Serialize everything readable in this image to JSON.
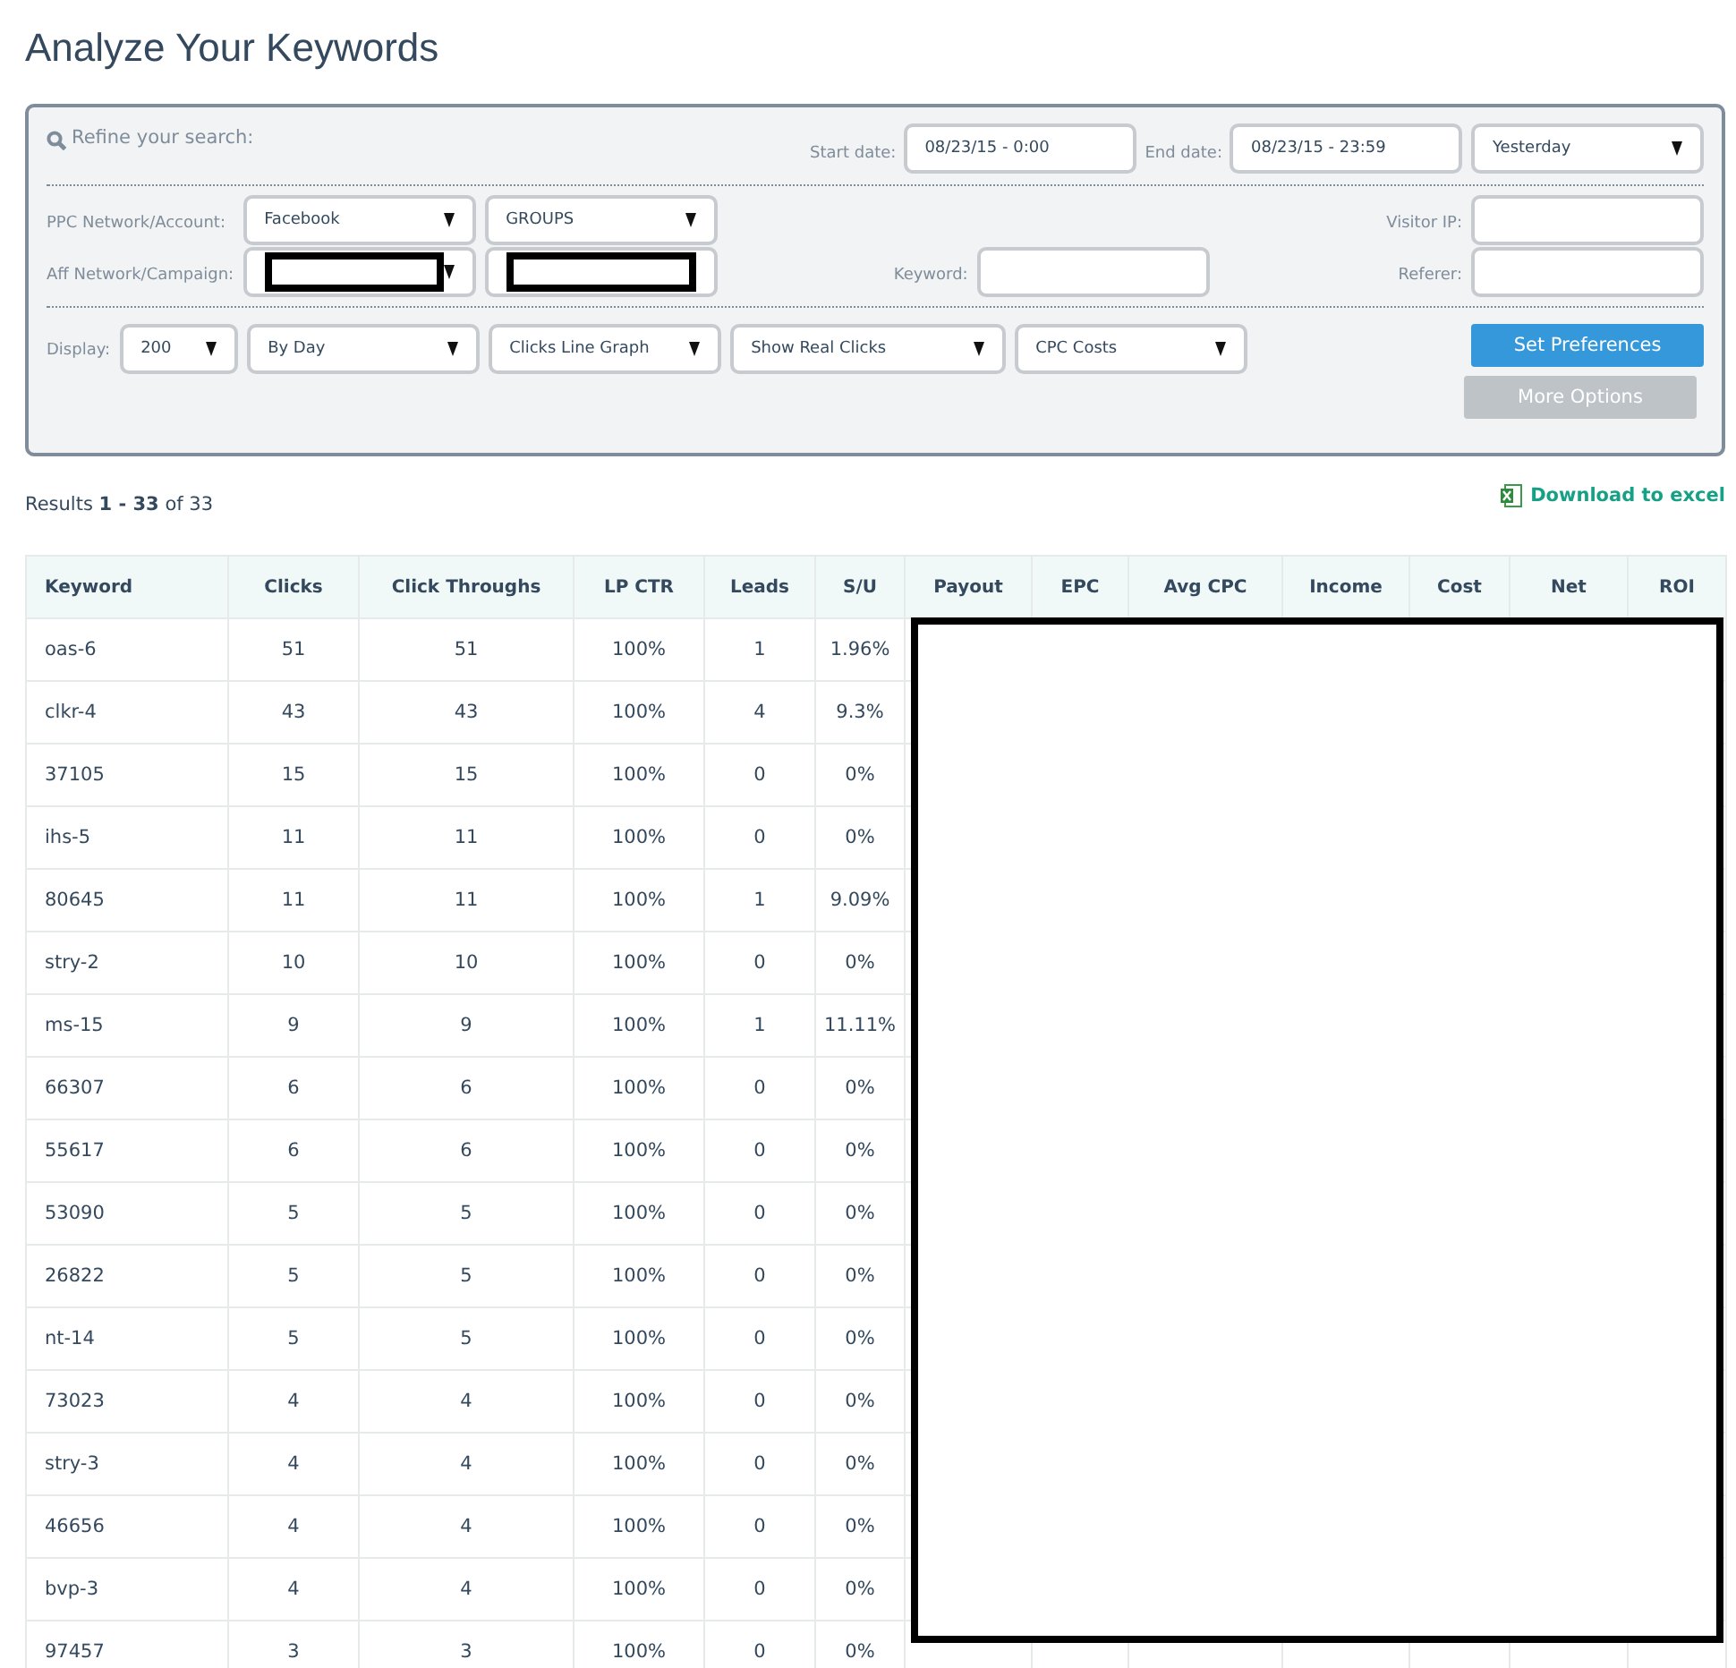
{
  "page_title": "Analyze Your Keywords",
  "filters": {
    "heading": "Refine your search:",
    "start_date": {
      "label": "Start date:",
      "value": "08/23/15 - 0:00"
    },
    "end_date": {
      "label": "End date:",
      "value": "08/23/15 - 23:59"
    },
    "range": {
      "value": "Yesterday"
    },
    "ppc": {
      "label": "PPC Network/Account:",
      "selects": [
        {
          "kind": "select",
          "value": "Facebook",
          "redacted": false
        },
        {
          "kind": "select",
          "value": "GROUPS",
          "redacted": false
        }
      ]
    },
    "aff": {
      "label": "Aff Network/Campaign:",
      "selects": [
        {
          "kind": "select",
          "redacted": true
        },
        {
          "kind": "field",
          "redacted": true
        }
      ]
    },
    "keyword": {
      "label": "Keyword:"
    },
    "visitor_ip": {
      "label": "Visitor IP:"
    },
    "referer": {
      "label": "Referer:"
    },
    "display": {
      "label": "Display:",
      "selects": [
        {
          "value": "200"
        },
        {
          "value": "By Day"
        },
        {
          "value": "Clicks Line Graph"
        },
        {
          "value": "Show Real Clicks"
        },
        {
          "value": "CPC Costs"
        }
      ]
    },
    "buttons": [
      {
        "label": "Set Preferences",
        "kind": "primary"
      },
      {
        "label": "More Options",
        "kind": "secondary"
      }
    ]
  },
  "results": "Results **1 - 33** of 33",
  "download": "Download to excel",
  "table": {
    "redacted": true,
    "columns": [
      "Keyword",
      "Clicks",
      "Click Throughs",
      "LP CTR",
      "Leads",
      "S/U",
      "Payout",
      "EPC",
      "Avg CPC",
      "Income",
      "Cost",
      "Net",
      "ROI"
    ],
    "rows": [
      [
        "oas-6",
        "51",
        "51",
        "100%",
        "1",
        "1.96%"
      ],
      [
        "clkr-4",
        "43",
        "43",
        "100%",
        "4",
        "9.3%"
      ],
      [
        "37105",
        "15",
        "15",
        "100%",
        "0",
        "0%"
      ],
      [
        "ihs-5",
        "11",
        "11",
        "100%",
        "0",
        "0%"
      ],
      [
        "80645",
        "11",
        "11",
        "100%",
        "1",
        "9.09%"
      ],
      [
        "stry-2",
        "10",
        "10",
        "100%",
        "0",
        "0%"
      ],
      [
        "ms-15",
        "9",
        "9",
        "100%",
        "1",
        "11.11%"
      ],
      [
        "66307",
        "6",
        "6",
        "100%",
        "0",
        "0%"
      ],
      [
        "55617",
        "6",
        "6",
        "100%",
        "0",
        "0%"
      ],
      [
        "53090",
        "5",
        "5",
        "100%",
        "0",
        "0%"
      ],
      [
        "26822",
        "5",
        "5",
        "100%",
        "0",
        "0%"
      ],
      [
        "nt-14",
        "5",
        "5",
        "100%",
        "0",
        "0%"
      ],
      [
        "73023",
        "4",
        "4",
        "100%",
        "0",
        "0%"
      ],
      [
        "stry-3",
        "4",
        "4",
        "100%",
        "0",
        "0%"
      ],
      [
        "46656",
        "4",
        "4",
        "100%",
        "0",
        "0%"
      ],
      [
        "bvp-3",
        "4",
        "4",
        "100%",
        "0",
        "0%"
      ],
      [
        "97457",
        "3",
        "3",
        "100%",
        "0",
        "0%"
      ]
    ]
  }
}
